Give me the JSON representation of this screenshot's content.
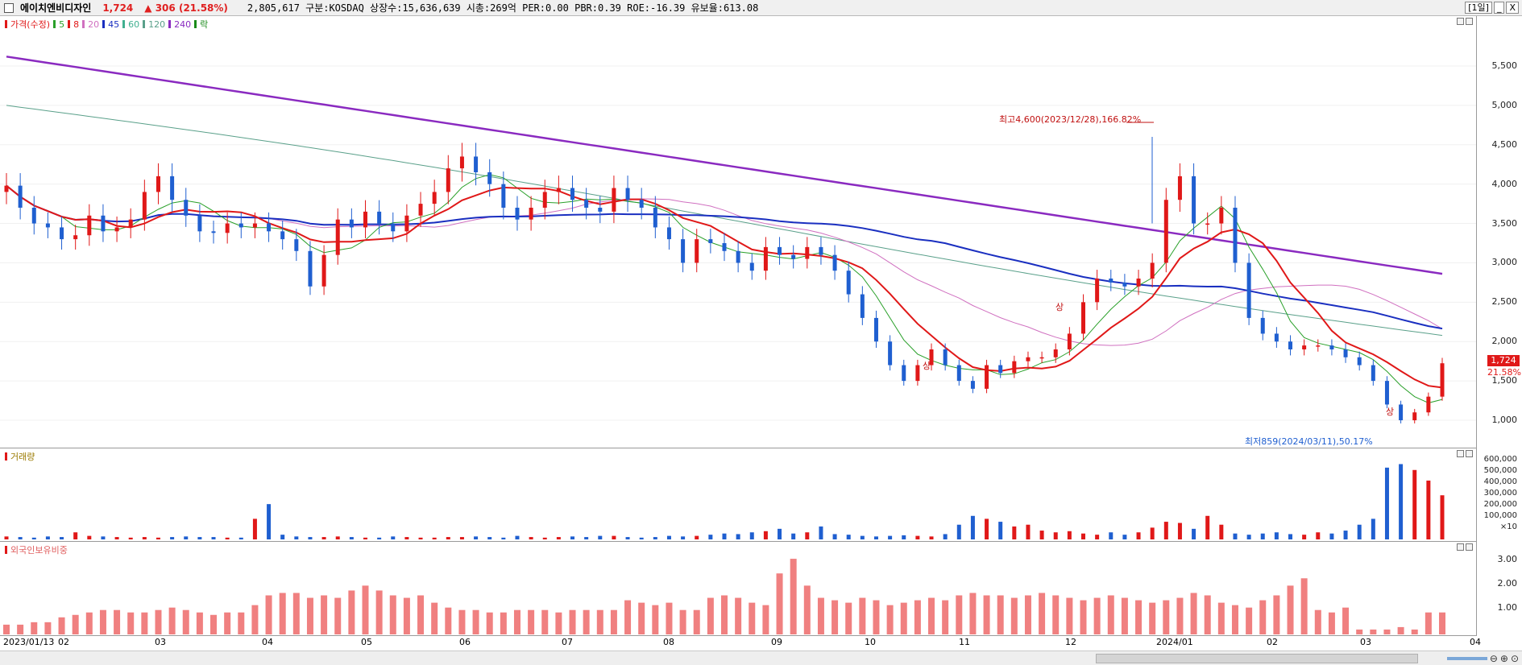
{
  "header": {
    "stock_name": "에이치엔비디자인",
    "price": "1,724",
    "change": "▲ 306",
    "change_pct": "(21.58%)",
    "info": "2,805,617  구분:KOSDAQ 상장수:15,636,639 시총:269억 PER:0.00 PBR:0.39 ROE:-16.39 유보율:613.08",
    "period_label": "[1일]",
    "min_btn": "_",
    "close_btn": "X"
  },
  "price_pane": {
    "legend": [
      {
        "label": "가격(수정)",
        "color": "#e01818"
      },
      {
        "label": "5",
        "color": "#2aa02a"
      },
      {
        "label": "8",
        "color": "#e01818"
      },
      {
        "label": "20",
        "color": "#d070c0"
      },
      {
        "label": "45",
        "color": "#1a2fc0"
      },
      {
        "label": "60",
        "color": "#40b090"
      },
      {
        "label": "120",
        "color": "#5aa08a"
      },
      {
        "label": "240",
        "color": "#8a2ac0"
      },
      {
        "label": "락",
        "color": "#1a8a1a"
      }
    ],
    "y_ticks": [
      "5,500",
      "5,000",
      "4,500",
      "4,000",
      "3,500",
      "3,000",
      "2,500",
      "2,000",
      "1,500",
      "1,000"
    ],
    "high_label": "최고4,600(2023/12/28),166.82%",
    "low_label": "최저859(2024/03/11),50.17%",
    "current_price_tag": "1,724",
    "current_pct_tag": "21.58%",
    "up_markers": [
      "상",
      "상",
      "상"
    ]
  },
  "volume_pane": {
    "legend": "거래량",
    "y_ticks": [
      "600,000",
      "500,000",
      "400,000",
      "300,000",
      "200,000",
      "100,000",
      "×10"
    ]
  },
  "foreign_pane": {
    "legend": "외국인보유비중",
    "y_ticks": [
      "3.00",
      "2.00",
      "1.00"
    ]
  },
  "x_axis": {
    "labels": [
      "2023/01/13",
      "02",
      "03",
      "04",
      "05",
      "06",
      "07",
      "08",
      "09",
      "10",
      "11",
      "12",
      "2024/01",
      "02",
      "03",
      "04"
    ]
  },
  "colors": {
    "up": "#e01818",
    "down": "#1f5fd0",
    "ma5": "#2aa02a",
    "ma8": "#e01818",
    "ma20": "#d070c0",
    "ma45": "#1a2fc0",
    "ma60": "#40b090",
    "ma240": "#8a2ac0",
    "foreign": "#f08080"
  },
  "chart_data": {
    "type": "candlestick",
    "x_start": "2023/01/13",
    "x_end": "2024/03/20",
    "ylim": [
      859,
      5800
    ],
    "close_series_approx": [
      3980,
      3700,
      3500,
      3450,
      3300,
      3350,
      3600,
      3400,
      3450,
      3550,
      3900,
      4100,
      3800,
      3600,
      3400,
      3380,
      3500,
      3450,
      3500,
      3400,
      3300,
      3150,
      2700,
      3100,
      3550,
      3450,
      3650,
      3500,
      3400,
      3600,
      3750,
      3900,
      4200,
      4350,
      4150,
      4000,
      3700,
      3550,
      3700,
      3900,
      3950,
      3800,
      3700,
      3650,
      3950,
      3800,
      3700,
      3450,
      3300,
      3000,
      3300,
      3250,
      3150,
      3000,
      2900,
      3200,
      3100,
      3050,
      3200,
      3100,
      2900,
      2600,
      2300,
      2000,
      1700,
      1500,
      1700,
      1900,
      1700,
      1500,
      1400,
      1700,
      1600,
      1750,
      1800,
      1800,
      1900,
      2100,
      2500,
      2800,
      2750,
      2700,
      2800,
      3000,
      3800,
      4100,
      3500,
      3500,
      3700,
      3000,
      2300,
      2100,
      2000,
      1900,
      1950,
      1950,
      1900,
      1800,
      1700,
      1500,
      1200,
      1000,
      1100,
      1300,
      1724
    ],
    "high": 4600,
    "high_date": "2023/12/28",
    "low": 859,
    "low_date": "2024/03/11",
    "last_close": 1724,
    "volume_series_approx": [
      5,
      4,
      3,
      5,
      4,
      12,
      6,
      5,
      4,
      3,
      4,
      3,
      4,
      5,
      4,
      4,
      3,
      3,
      35,
      60,
      8,
      5,
      4,
      4,
      5,
      4,
      3,
      3,
      5,
      4,
      3,
      3,
      4,
      4,
      5,
      4,
      3,
      6,
      4,
      3,
      4,
      5,
      4,
      6,
      6,
      4,
      3,
      4,
      6,
      5,
      6,
      8,
      10,
      9,
      12,
      14,
      18,
      10,
      12,
      22,
      9,
      8,
      6,
      5,
      6,
      7,
      6,
      5,
      9,
      25,
      40,
      35,
      30,
      22,
      25,
      15,
      12,
      14,
      10,
      8,
      12,
      8,
      12,
      20,
      30,
      28,
      18,
      40,
      25,
      10,
      8,
      10,
      12,
      9,
      8,
      12,
      10,
      15,
      25,
      35,
      122,
      128,
      118,
      100,
      75
    ],
    "foreign_ratio_approx": [
      0.4,
      0.4,
      0.5,
      0.5,
      0.7,
      0.8,
      0.9,
      1.0,
      1.0,
      0.9,
      0.9,
      1.0,
      1.1,
      1.0,
      0.9,
      0.8,
      0.9,
      0.9,
      1.2,
      1.6,
      1.7,
      1.7,
      1.5,
      1.6,
      1.5,
      1.8,
      2.0,
      1.8,
      1.6,
      1.5,
      1.6,
      1.3,
      1.1,
      1.0,
      1.0,
      0.9,
      0.9,
      1.0,
      1.0,
      1.0,
      0.9,
      1.0,
      1.0,
      1.0,
      1.0,
      1.4,
      1.3,
      1.2,
      1.3,
      1.0,
      1.0,
      1.5,
      1.6,
      1.5,
      1.3,
      1.2,
      2.5,
      3.1,
      2.0,
      1.5,
      1.4,
      1.3,
      1.5,
      1.4,
      1.2,
      1.3,
      1.4,
      1.5,
      1.4,
      1.6,
      1.7,
      1.6,
      1.6,
      1.5,
      1.6,
      1.7,
      1.6,
      1.5,
      1.4,
      1.5,
      1.6,
      1.5,
      1.4,
      1.3,
      1.4,
      1.5,
      1.7,
      1.6,
      1.3,
      1.2,
      1.1,
      1.4,
      1.6,
      2.0,
      2.3,
      1.0,
      0.9,
      1.1,
      0.2,
      0.2,
      0.2,
      0.3,
      0.2,
      0.9,
      0.9
    ]
  }
}
